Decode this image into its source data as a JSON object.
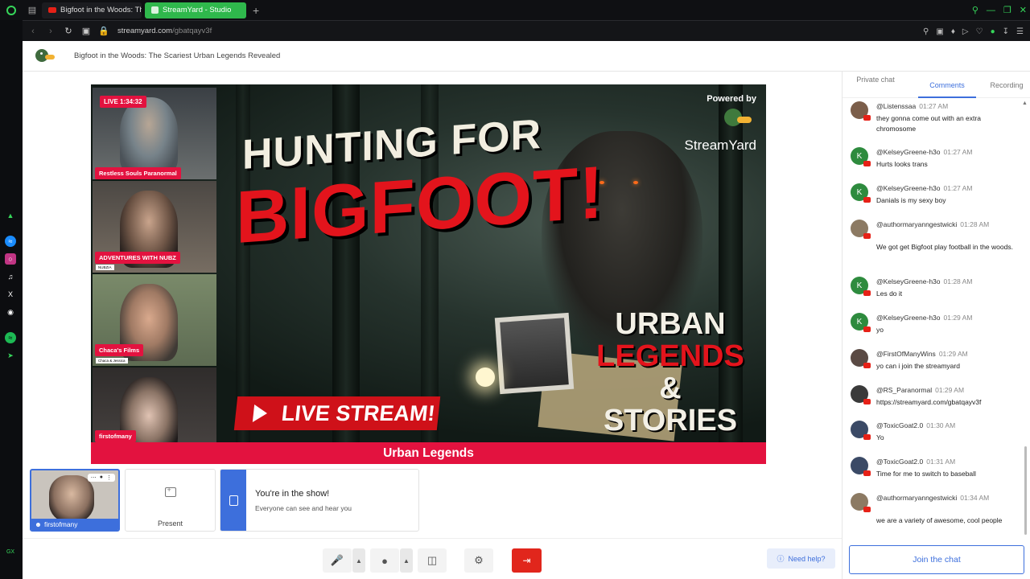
{
  "browser": {
    "tabs": [
      {
        "label": "Bigfoot in the Woods: The"
      },
      {
        "label": "StreamYard - Studio"
      }
    ],
    "url_host": "streamyard.com",
    "url_path": "/gbatqayv3f"
  },
  "header": {
    "title": "Bigfoot in the Woods: The Scariest Urban Legends Revealed"
  },
  "stage": {
    "live_badge": "LIVE 1:34:32",
    "powered_by": "Powered by",
    "powered_brand": "StreamYard",
    "headline_top": "HUNTING FOR",
    "headline_main": "BIGFOOT!",
    "urban_1": "URBAN",
    "urban_2": "LEGENDS",
    "urban_3": "& STORIES",
    "live_stream": "LIVE STREAM!",
    "banner": "Urban Legends",
    "cams": [
      {
        "name": "Restless Souls Paranormal",
        "sub": ""
      },
      {
        "name": "ADVENTURES WITH NUBZ",
        "sub": "NUBZIA"
      },
      {
        "name": "Chaca's Films",
        "sub": "Chaca & Jessica"
      },
      {
        "name": "firstofmany",
        "sub": ""
      }
    ]
  },
  "preview": {
    "name": "firstofmany",
    "present_label": "Present",
    "show_title": "You're in the show!",
    "show_subtitle": "Everyone can see and hear you"
  },
  "controls": {
    "help_label": "Need help?"
  },
  "chat": {
    "tabs": [
      "Private chat",
      "Comments",
      "Recording"
    ],
    "active_tab": "Comments",
    "messages": [
      {
        "author": "@Listenssaa",
        "time": "01:27 AM",
        "text": "they gonna come out with an extra chromosome",
        "avatar": "photo"
      },
      {
        "author": "@KelseyGreene-h3o",
        "time": "01:27 AM",
        "text": "Hurts looks trans",
        "avatar": "K"
      },
      {
        "author": "@KelseyGreene-h3o",
        "time": "01:27 AM",
        "text": "Danials is my sexy boy",
        "avatar": "K"
      },
      {
        "author": "@authormaryanngestwicki",
        "time": "01:28 AM",
        "text": "We got get Bigfoot play football in the woods.",
        "avatar": "photo"
      },
      {
        "author": "@KelseyGreene-h3o",
        "time": "01:28 AM",
        "text": "Les do it",
        "avatar": "K"
      },
      {
        "author": "@KelseyGreene-h3o",
        "time": "01:29 AM",
        "text": "yo",
        "avatar": "K"
      },
      {
        "author": "@FirstOfManyWins",
        "time": "01:29 AM",
        "text": "yo can i join the streamyard",
        "avatar": "photo"
      },
      {
        "author": "@RS_Paranormal",
        "time": "01:29 AM",
        "text": "https://streamyard.com/gbatqayv3f",
        "avatar": "photo"
      },
      {
        "author": "@ToxicGoat2.0",
        "time": "01:30 AM",
        "text": "Yo",
        "avatar": "photo"
      },
      {
        "author": "@ToxicGoat2.0",
        "time": "01:31 AM",
        "text": "Time for me to switch to baseball",
        "avatar": "photo"
      },
      {
        "author": "@authormaryanngestwicki",
        "time": "01:34 AM",
        "text": "we are a variety of awesome, cool people",
        "avatar": "photo"
      }
    ],
    "join_label": "Join the chat"
  },
  "colors": {
    "accent": "#3d6fdc",
    "live_red": "#e3123f",
    "opera_green": "#36d65a",
    "leave_red": "#e1261c"
  }
}
